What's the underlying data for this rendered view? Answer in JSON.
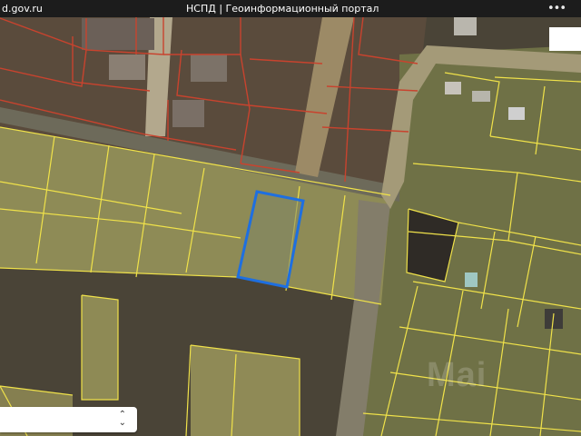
{
  "topbar": {
    "url": "d.gov.ru",
    "title": "НСПД | Геоинформационный портал",
    "more_icon": "more-dots-icon"
  },
  "map": {
    "selected_parcel_color": "#1e6fe0",
    "parcel_border_color": "#f0e24a",
    "boundary_red": "#c8432e"
  },
  "layer_select": {
    "value": "",
    "icon": "updown-chevron-icon"
  },
  "watermark": {
    "text": "Mai"
  }
}
